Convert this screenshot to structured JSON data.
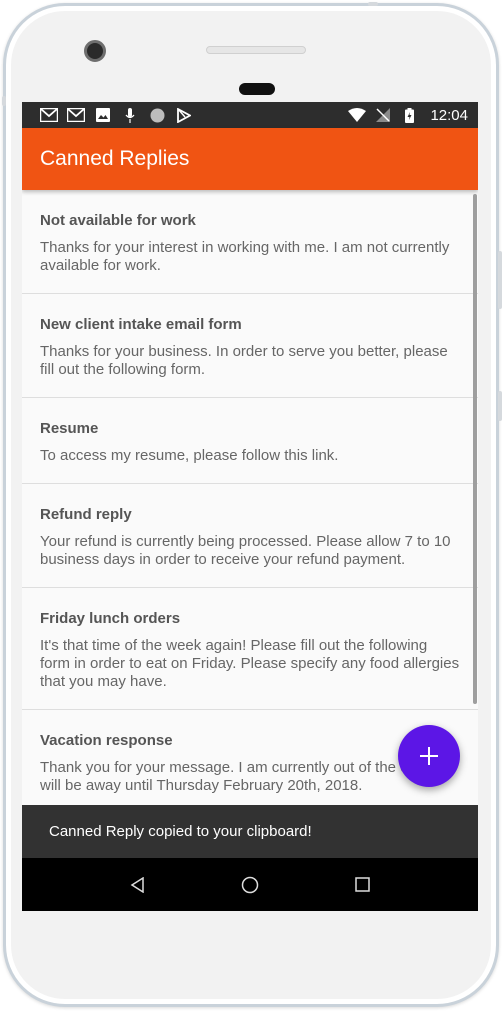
{
  "status_bar": {
    "time": "12:04",
    "icons_left": [
      "gmail-icon",
      "gmail-icon",
      "image-icon",
      "mic-icon",
      "circle-icon",
      "play-store-icon"
    ],
    "icons_right": [
      "wifi-icon",
      "no-signal-icon",
      "battery-icon"
    ]
  },
  "app_bar": {
    "title": "Canned Replies",
    "color": "#f05413"
  },
  "replies": [
    {
      "title": "Not available for work",
      "body": "Thanks for your interest in working with me. I am not currently available for work."
    },
    {
      "title": "New client intake email form",
      "body": "Thanks for your business. In order to serve you better, please fill out the following form."
    },
    {
      "title": "Resume",
      "body": "To access my resume, please follow this link."
    },
    {
      "title": "Refund reply",
      "body": "Your refund is currently being processed. Please allow 7 to 10 business days in order to receive your refund payment."
    },
    {
      "title": "Friday lunch orders",
      "body": "It's that time of the week again! Please fill out the following form in order to eat on Friday. Please specify any food allergies that you may have."
    },
    {
      "title": "Vacation response",
      "body": "Thank you for your message. I am currently out of the office. I will be away until Thursday February 20th, 2018."
    }
  ],
  "fab": {
    "icon": "plus-icon",
    "color": "#5c16e6"
  },
  "snackbar": {
    "message": "Canned Reply copied to your clipboard!"
  },
  "nav_bar": {
    "icons": [
      "back-icon",
      "home-icon",
      "recents-icon"
    ]
  }
}
